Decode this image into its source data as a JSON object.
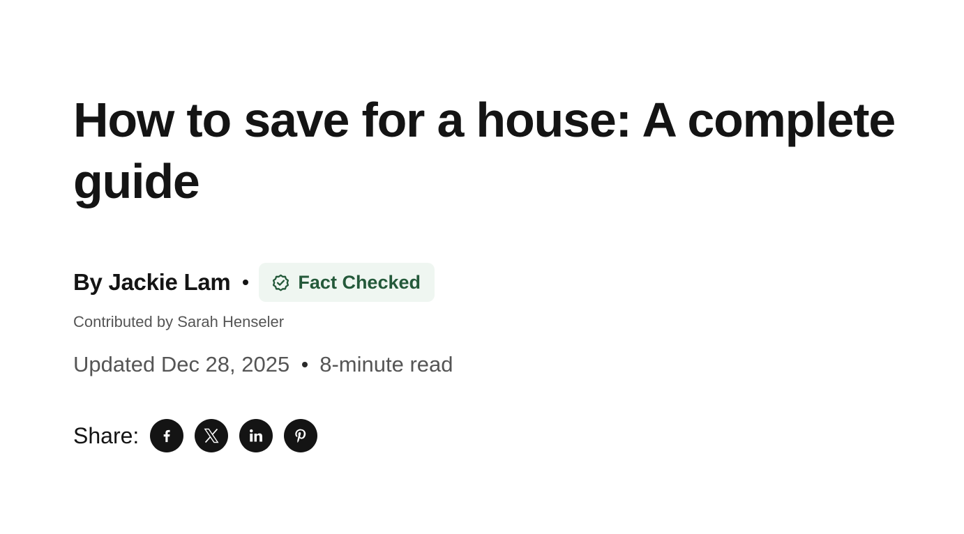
{
  "article": {
    "title": "How to save for a house: A complete guide",
    "author": "By Jackie Lam",
    "badge_label": "Fact Checked",
    "contributor": "Contributed by Sarah Henseler",
    "updated": "Updated Dec 28, 2025",
    "read_time": "8-minute read"
  },
  "share": {
    "label": "Share:",
    "networks": [
      {
        "name": "facebook",
        "icon": "facebook-icon"
      },
      {
        "name": "x",
        "icon": "x-icon"
      },
      {
        "name": "linkedin",
        "icon": "linkedin-icon"
      },
      {
        "name": "pinterest",
        "icon": "pinterest-icon"
      }
    ]
  },
  "colors": {
    "text": "#141414",
    "muted": "#555555",
    "badge_bg": "#eff6f1",
    "badge_text": "#24593a",
    "social_bg": "#141414"
  }
}
